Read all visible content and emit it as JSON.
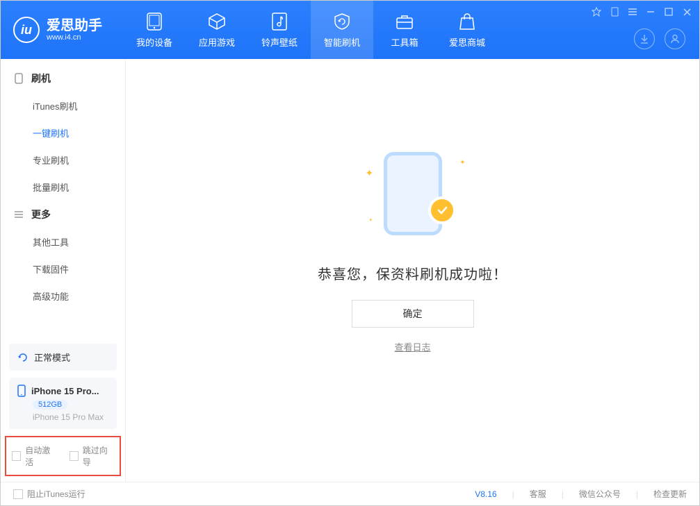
{
  "app": {
    "title": "爱思助手",
    "subtitle": "www.i4.cn"
  },
  "nav": {
    "items": [
      {
        "label": "我的设备"
      },
      {
        "label": "应用游戏"
      },
      {
        "label": "铃声壁纸"
      },
      {
        "label": "智能刷机"
      },
      {
        "label": "工具箱"
      },
      {
        "label": "爱思商城"
      }
    ]
  },
  "sidebar": {
    "group1": "刷机",
    "items1": [
      {
        "label": "iTunes刷机"
      },
      {
        "label": "一键刷机"
      },
      {
        "label": "专业刷机"
      },
      {
        "label": "批量刷机"
      }
    ],
    "group2": "更多",
    "items2": [
      {
        "label": "其他工具"
      },
      {
        "label": "下载固件"
      },
      {
        "label": "高级功能"
      }
    ],
    "status": "正常模式",
    "device": {
      "name": "iPhone 15 Pro...",
      "storage": "512GB",
      "full": "iPhone 15 Pro Max"
    },
    "checkbox1": "自动激活",
    "checkbox2": "跳过向导"
  },
  "main": {
    "success_msg": "恭喜您，保资料刷机成功啦！",
    "ok": "确定",
    "view_log": "查看日志"
  },
  "footer": {
    "block_itunes": "阻止iTunes运行",
    "version": "V8.16",
    "support": "客服",
    "wechat": "微信公众号",
    "update": "检查更新"
  }
}
